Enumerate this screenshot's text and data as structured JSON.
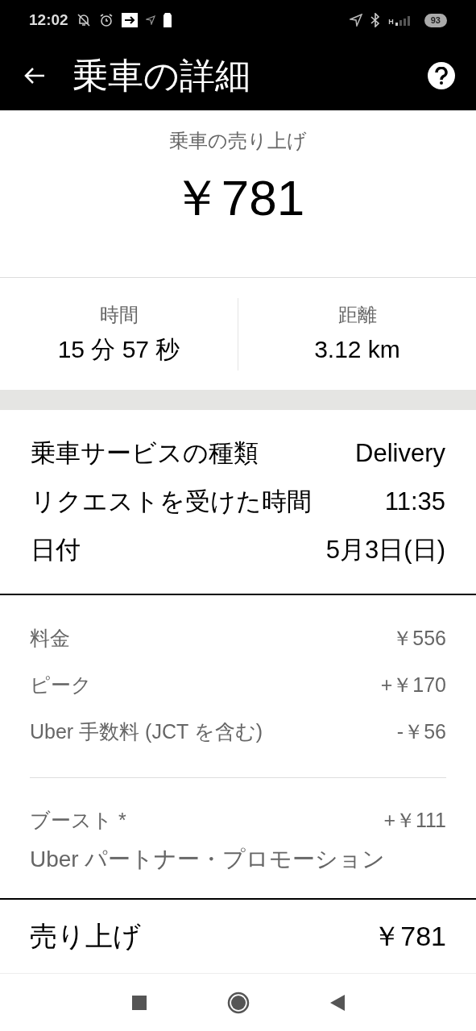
{
  "status_bar": {
    "time": "12:02",
    "network": "H",
    "battery": "93"
  },
  "header": {
    "title": "乗車の詳細"
  },
  "earnings": {
    "label": "乗車の売り上げ",
    "amount": "￥781"
  },
  "stats": [
    {
      "label": "時間",
      "value": "15 分 57 秒"
    },
    {
      "label": "距離",
      "value": "3.12 km"
    }
  ],
  "details": [
    {
      "label": "乗車サービスの種類",
      "value": "Delivery"
    },
    {
      "label": "リクエストを受けた時間",
      "value": "11:35"
    },
    {
      "label": "日付",
      "value": "5月3日(日)"
    }
  ],
  "fees": [
    {
      "label": "料金",
      "value": "￥556"
    },
    {
      "label": "ピーク",
      "value": "+￥170"
    },
    {
      "label": "Uber 手数料 (JCT を含む)",
      "value": "-￥56"
    }
  ],
  "boost": {
    "label": "ブースト *",
    "value": "+￥111",
    "note": "Uber パートナー・プロモーション"
  },
  "total": {
    "label": "売り上げ",
    "value": "￥781"
  }
}
